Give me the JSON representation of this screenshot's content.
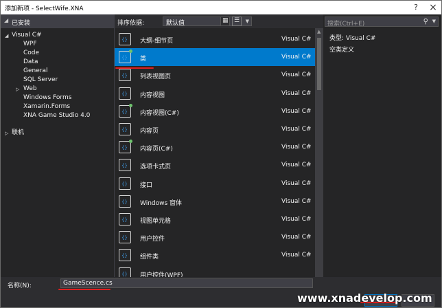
{
  "window": {
    "title": "添加新项 - SelectWife.XNA",
    "help": "?",
    "close": "×"
  },
  "left": {
    "header": "已安装",
    "tree": [
      {
        "label": "Visual C#",
        "level": 0,
        "arrow": "◢"
      },
      {
        "label": "WPF",
        "level": 1
      },
      {
        "label": "Code",
        "level": 1
      },
      {
        "label": "Data",
        "level": 1
      },
      {
        "label": "General",
        "level": 1
      },
      {
        "label": "SQL Server",
        "level": 1
      },
      {
        "label": "Web",
        "level": 1,
        "arrow": "▷"
      },
      {
        "label": "Windows Forms",
        "level": 1
      },
      {
        "label": "Xamarin.Forms",
        "level": 1
      },
      {
        "label": "XNA Game Studio 4.0",
        "level": 1
      },
      {
        "label": "联机",
        "level": 0,
        "arrow": "▷"
      }
    ]
  },
  "toolbar": {
    "sort_label": "排序依据:",
    "sort_value": "默认值"
  },
  "items": [
    {
      "name": "大纲-细节页",
      "lang": "Visual C#",
      "icon": "page-icon"
    },
    {
      "name": "类",
      "lang": "Visual C#",
      "icon": "class-icon",
      "selected": true
    },
    {
      "name": "列表视图页",
      "lang": "Visual C#",
      "icon": "page-icon"
    },
    {
      "name": "内容视图",
      "lang": "Visual C#",
      "icon": "page-icon"
    },
    {
      "name": "内容视图(C#)",
      "lang": "Visual C#",
      "icon": "class-icon"
    },
    {
      "name": "内容页",
      "lang": "Visual C#",
      "icon": "page-icon"
    },
    {
      "name": "内容页(C#)",
      "lang": "Visual C#",
      "icon": "class-icon"
    },
    {
      "name": "选项卡式页",
      "lang": "Visual C#",
      "icon": "page-icon"
    },
    {
      "name": "接口",
      "lang": "Visual C#",
      "icon": "interface-icon"
    },
    {
      "name": "Windows 窗体",
      "lang": "Visual C#",
      "icon": "form-icon"
    },
    {
      "name": "视图单元格",
      "lang": "Visual C#",
      "icon": "page-icon"
    },
    {
      "name": "用户控件",
      "lang": "Visual C#",
      "icon": "user-control-icon"
    },
    {
      "name": "组件类",
      "lang": "Visual C#",
      "icon": "component-icon"
    },
    {
      "name": "用户控件(WPF)",
      "lang": "",
      "icon": "user-control-icon"
    }
  ],
  "right": {
    "search_placeholder": "搜索(Ctrl+E)",
    "type_line": "类型:  Visual C#",
    "description": "空类定义"
  },
  "bottom": {
    "name_label": "名称(N):",
    "name_value": "GameScence.cs"
  },
  "watermark": "www.xnadevelop.com",
  "colors": {
    "accent": "#007acc",
    "background": "#252526",
    "annotation": "#e02020"
  }
}
